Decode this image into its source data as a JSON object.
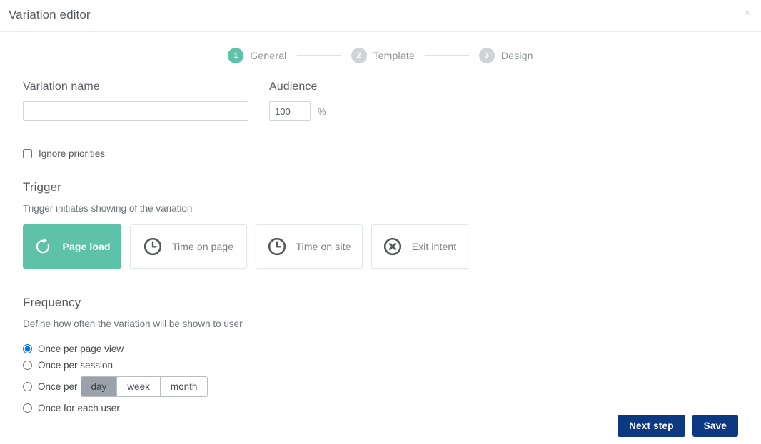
{
  "header": {
    "title": "Variation editor",
    "close_icon": "close-icon",
    "close_label": "×"
  },
  "stepper": {
    "steps": [
      {
        "number": "1",
        "label": "General",
        "state": "active"
      },
      {
        "number": "2",
        "label": "Template",
        "state": "inactive"
      },
      {
        "number": "3",
        "label": "Design",
        "state": "inactive"
      }
    ],
    "active_color": "#5ec2a9",
    "inactive_color": "#cfd3d6"
  },
  "form": {
    "variation_name": {
      "label": "Variation name",
      "value": "",
      "placeholder": ""
    },
    "audience": {
      "label": "Audience",
      "value": "100",
      "suffix": "%"
    },
    "ignore_priorities": {
      "label": "Ignore priorities",
      "checked": false
    }
  },
  "trigger": {
    "title": "Trigger",
    "subtitle": "Trigger initiates showing of the variation",
    "selected": "Page load",
    "options": [
      {
        "label": "Page load",
        "icon": "refresh-icon",
        "selected": true
      },
      {
        "label": "Time on page",
        "icon": "clock-icon",
        "selected": false
      },
      {
        "label": "Time on site",
        "icon": "clock-icon",
        "selected": false
      },
      {
        "label": "Exit intent",
        "icon": "close-circle-icon",
        "selected": false
      }
    ]
  },
  "frequency": {
    "title": "Frequency",
    "subtitle": "Define how often the variation will be shown to user",
    "selected": "Once per page view",
    "options": [
      {
        "label": "Once per page view",
        "selected": true
      },
      {
        "label": "Once per session",
        "selected": false
      },
      {
        "label": "Once per",
        "selected": false,
        "has_segmented": true
      },
      {
        "label": "Once for each user",
        "selected": false
      }
    ],
    "period_segments": [
      {
        "label": "day",
        "active": true
      },
      {
        "label": "week",
        "active": false
      },
      {
        "label": "month",
        "active": false
      }
    ]
  },
  "footer": {
    "next_label": "Next step",
    "save_label": "Save",
    "button_color": "#0d3882"
  }
}
